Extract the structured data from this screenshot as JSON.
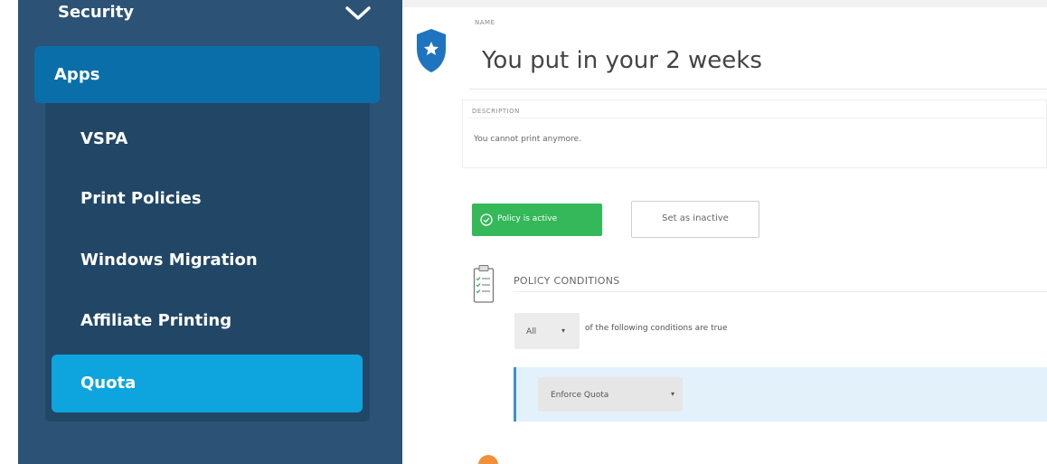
{
  "sidebar": {
    "section_label": "Security",
    "active_group": "Apps",
    "items": [
      {
        "label": "VSPA"
      },
      {
        "label": "Print Policies"
      },
      {
        "label": "Windows Migration"
      },
      {
        "label": "Affiliate Printing"
      },
      {
        "label": "Quota"
      }
    ],
    "active_item": "Quota"
  },
  "main": {
    "name_label": "NAME",
    "name_value": "You put in your 2 weeks",
    "description_label": "DESCRIPTION",
    "description_value": "You cannot print anymore.",
    "status_button": "Policy is active",
    "toggle_button": "Set as inactive",
    "conditions_heading": "POLICY CONDITIONS",
    "match_select": "All",
    "match_text": "of the following conditions are true",
    "rule_select": "Enforce Quota"
  },
  "colors": {
    "sidebar_bg": "#2c5276",
    "apps_bg": "#0a6fa8",
    "active_item_bg": "#0ea5df",
    "active_button": "#35b85a"
  },
  "icons": [
    "chevron-down-icon",
    "shield-star-icon",
    "check-circle-icon",
    "clipboard-checklist-icon"
  ]
}
